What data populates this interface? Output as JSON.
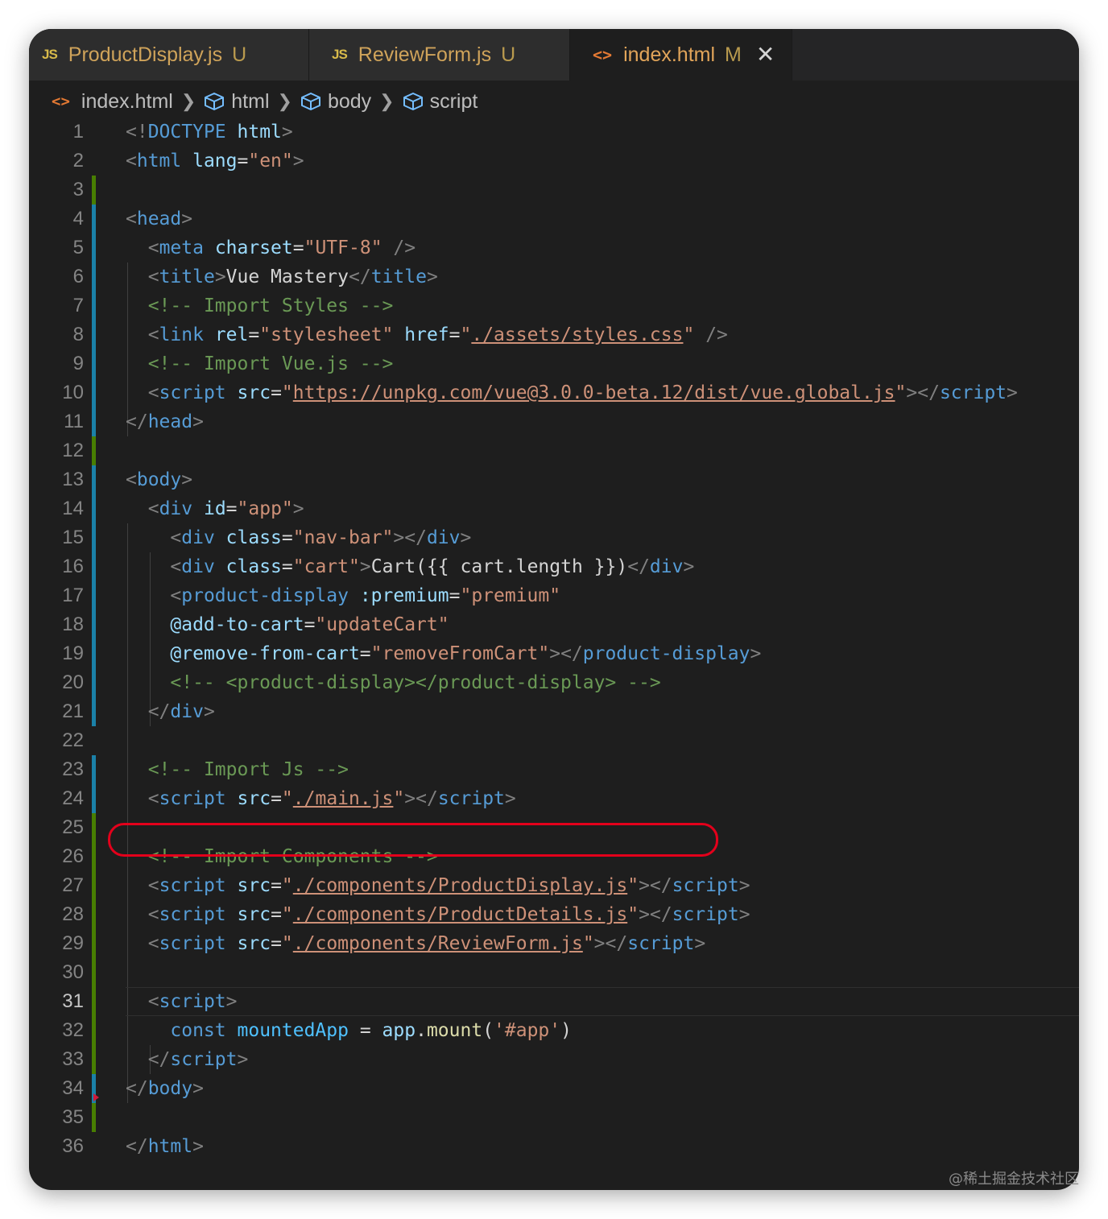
{
  "tabs": [
    {
      "icon": "JS",
      "label": "ProductDisplay.js",
      "status": "U"
    },
    {
      "icon": "JS",
      "label": "ReviewForm.js",
      "status": "U"
    },
    {
      "icon": "<>",
      "label": "index.html",
      "status": "M",
      "close": "✕"
    }
  ],
  "breadcrumb": [
    "index.html",
    "html",
    "body",
    "script"
  ],
  "current_line": 31,
  "lines": [
    [
      [
        "p",
        "<!"
      ],
      [
        "t",
        "DOCTYPE"
      ],
      [
        "d",
        " "
      ],
      [
        "a",
        "html"
      ],
      [
        "p",
        ">"
      ]
    ],
    [
      [
        "p",
        "<"
      ],
      [
        "t",
        "html"
      ],
      [
        "d",
        " "
      ],
      [
        "a",
        "lang"
      ],
      [
        "d",
        "="
      ],
      [
        "s",
        "\"en\""
      ],
      [
        "p",
        ">"
      ]
    ],
    [],
    [
      [
        "p",
        "<"
      ],
      [
        "t",
        "head"
      ],
      [
        "p",
        ">"
      ]
    ],
    [
      [
        "d",
        "  "
      ],
      [
        "p",
        "<"
      ],
      [
        "t",
        "meta"
      ],
      [
        "d",
        " "
      ],
      [
        "a",
        "charset"
      ],
      [
        "d",
        "="
      ],
      [
        "s",
        "\"UTF-8\""
      ],
      [
        "d",
        " "
      ],
      [
        "p",
        "/>"
      ]
    ],
    [
      [
        "d",
        "  "
      ],
      [
        "p",
        "<"
      ],
      [
        "t",
        "title"
      ],
      [
        "p",
        ">"
      ],
      [
        "d",
        "Vue Mastery"
      ],
      [
        "p",
        "</"
      ],
      [
        "t",
        "title"
      ],
      [
        "p",
        ">"
      ]
    ],
    [
      [
        "d",
        "  "
      ],
      [
        "c",
        "<!-- Import Styles -->"
      ]
    ],
    [
      [
        "d",
        "  "
      ],
      [
        "p",
        "<"
      ],
      [
        "t",
        "link"
      ],
      [
        "d",
        " "
      ],
      [
        "a",
        "rel"
      ],
      [
        "d",
        "="
      ],
      [
        "s",
        "\"stylesheet\""
      ],
      [
        "d",
        " "
      ],
      [
        "a",
        "href"
      ],
      [
        "d",
        "="
      ],
      [
        "s",
        "\""
      ],
      [
        "u",
        "./assets/styles.css"
      ],
      [
        "s",
        "\""
      ],
      [
        "d",
        " "
      ],
      [
        "p",
        "/>"
      ]
    ],
    [
      [
        "d",
        "  "
      ],
      [
        "c",
        "<!-- Import Vue.js -->"
      ]
    ],
    [
      [
        "d",
        "  "
      ],
      [
        "p",
        "<"
      ],
      [
        "t",
        "script"
      ],
      [
        "d",
        " "
      ],
      [
        "a",
        "src"
      ],
      [
        "d",
        "="
      ],
      [
        "s",
        "\""
      ],
      [
        "u",
        "https://unpkg.com/vue@3.0.0-beta.12/dist/vue.global.js"
      ],
      [
        "s",
        "\""
      ],
      [
        "p",
        "></"
      ],
      [
        "t",
        "script"
      ],
      [
        "p",
        ">"
      ]
    ],
    [
      [
        "p",
        "</"
      ],
      [
        "t",
        "head"
      ],
      [
        "p",
        ">"
      ]
    ],
    [],
    [
      [
        "p",
        "<"
      ],
      [
        "t",
        "body"
      ],
      [
        "p",
        ">"
      ]
    ],
    [
      [
        "d",
        "  "
      ],
      [
        "p",
        "<"
      ],
      [
        "t",
        "div"
      ],
      [
        "d",
        " "
      ],
      [
        "a",
        "id"
      ],
      [
        "d",
        "="
      ],
      [
        "s",
        "\"app\""
      ],
      [
        "p",
        ">"
      ]
    ],
    [
      [
        "d",
        "    "
      ],
      [
        "p",
        "<"
      ],
      [
        "t",
        "div"
      ],
      [
        "d",
        " "
      ],
      [
        "a",
        "class"
      ],
      [
        "d",
        "="
      ],
      [
        "s",
        "\"nav-bar\""
      ],
      [
        "p",
        "></"
      ],
      [
        "t",
        "div"
      ],
      [
        "p",
        ">"
      ]
    ],
    [
      [
        "d",
        "    "
      ],
      [
        "p",
        "<"
      ],
      [
        "t",
        "div"
      ],
      [
        "d",
        " "
      ],
      [
        "a",
        "class"
      ],
      [
        "d",
        "="
      ],
      [
        "s",
        "\"cart\""
      ],
      [
        "p",
        ">"
      ],
      [
        "d",
        "Cart({{ cart.length }})"
      ],
      [
        "p",
        "</"
      ],
      [
        "t",
        "div"
      ],
      [
        "p",
        ">"
      ]
    ],
    [
      [
        "d",
        "    "
      ],
      [
        "p",
        "<"
      ],
      [
        "t",
        "product-display"
      ],
      [
        "d",
        " "
      ],
      [
        "a",
        ":premium"
      ],
      [
        "d",
        "="
      ],
      [
        "s",
        "\"premium\""
      ]
    ],
    [
      [
        "d",
        "    "
      ],
      [
        "a",
        "@add-to-cart"
      ],
      [
        "d",
        "="
      ],
      [
        "s",
        "\"updateCart\""
      ]
    ],
    [
      [
        "d",
        "    "
      ],
      [
        "a",
        "@remove-from-cart"
      ],
      [
        "d",
        "="
      ],
      [
        "s",
        "\"removeFromCart\""
      ],
      [
        "p",
        "></"
      ],
      [
        "t",
        "product-display"
      ],
      [
        "p",
        ">"
      ]
    ],
    [
      [
        "d",
        "    "
      ],
      [
        "c",
        "<!-- <product-display></product-display> -->"
      ]
    ],
    [
      [
        "d",
        "  "
      ],
      [
        "p",
        "</"
      ],
      [
        "t",
        "div"
      ],
      [
        "p",
        ">"
      ]
    ],
    [],
    [
      [
        "d",
        "  "
      ],
      [
        "c",
        "<!-- Import Js -->"
      ]
    ],
    [
      [
        "d",
        "  "
      ],
      [
        "p",
        "<"
      ],
      [
        "t",
        "script"
      ],
      [
        "d",
        " "
      ],
      [
        "a",
        "src"
      ],
      [
        "d",
        "="
      ],
      [
        "s",
        "\""
      ],
      [
        "u",
        "./main.js"
      ],
      [
        "s",
        "\""
      ],
      [
        "p",
        "></"
      ],
      [
        "t",
        "script"
      ],
      [
        "p",
        ">"
      ]
    ],
    [],
    [
      [
        "d",
        "  "
      ],
      [
        "c",
        "<!-- Import Components -->"
      ]
    ],
    [
      [
        "d",
        "  "
      ],
      [
        "p",
        "<"
      ],
      [
        "t",
        "script"
      ],
      [
        "d",
        " "
      ],
      [
        "a",
        "src"
      ],
      [
        "d",
        "="
      ],
      [
        "s",
        "\""
      ],
      [
        "u",
        "./components/ProductDisplay.js"
      ],
      [
        "s",
        "\""
      ],
      [
        "p",
        "></"
      ],
      [
        "t",
        "script"
      ],
      [
        "p",
        ">"
      ]
    ],
    [
      [
        "d",
        "  "
      ],
      [
        "p",
        "<"
      ],
      [
        "t",
        "script"
      ],
      [
        "d",
        " "
      ],
      [
        "a",
        "src"
      ],
      [
        "d",
        "="
      ],
      [
        "s",
        "\""
      ],
      [
        "u",
        "./components/ProductDetails.js"
      ],
      [
        "s",
        "\""
      ],
      [
        "p",
        "></"
      ],
      [
        "t",
        "script"
      ],
      [
        "p",
        ">"
      ]
    ],
    [
      [
        "d",
        "  "
      ],
      [
        "p",
        "<"
      ],
      [
        "t",
        "script"
      ],
      [
        "d",
        " "
      ],
      [
        "a",
        "src"
      ],
      [
        "d",
        "="
      ],
      [
        "s",
        "\""
      ],
      [
        "u",
        "./components/ReviewForm.js"
      ],
      [
        "s",
        "\""
      ],
      [
        "p",
        "></"
      ],
      [
        "t",
        "script"
      ],
      [
        "p",
        ">"
      ]
    ],
    [],
    [
      [
        "d",
        "  "
      ],
      [
        "p",
        "<"
      ],
      [
        "t",
        "script"
      ],
      [
        "p",
        ">"
      ]
    ],
    [
      [
        "d",
        "    "
      ],
      [
        "k",
        "const"
      ],
      [
        "d",
        " "
      ],
      [
        "v",
        "mountedApp"
      ],
      [
        "d",
        " = "
      ],
      [
        "a",
        "app"
      ],
      [
        "d",
        "."
      ],
      [
        "f",
        "mount"
      ],
      [
        "d",
        "("
      ],
      [
        "s",
        "'#app'"
      ],
      [
        "d",
        ")"
      ]
    ],
    [
      [
        "d",
        "  "
      ],
      [
        "p",
        "</"
      ],
      [
        "t",
        "script"
      ],
      [
        "p",
        ">"
      ]
    ],
    [
      [
        "p",
        "</"
      ],
      [
        "t",
        "body"
      ],
      [
        "p",
        ">"
      ]
    ],
    [],
    [
      [
        "p",
        "</"
      ],
      [
        "t",
        "html"
      ],
      [
        "p",
        ">"
      ]
    ]
  ],
  "gutter": [
    "",
    "",
    "add",
    "mod",
    "mod",
    "mod",
    "mod",
    "mod",
    "mod",
    "mod",
    "mod",
    "add",
    "mod",
    "mod",
    "mod",
    "mod",
    "mod",
    "mod",
    "mod",
    "mod",
    "mod",
    "",
    "mod",
    "mod",
    "add",
    "add",
    "add",
    "add",
    "add",
    "add",
    "add",
    "add",
    "add",
    "mod",
    "add",
    ""
  ],
  "watermark": "@稀土掘金技术社区"
}
